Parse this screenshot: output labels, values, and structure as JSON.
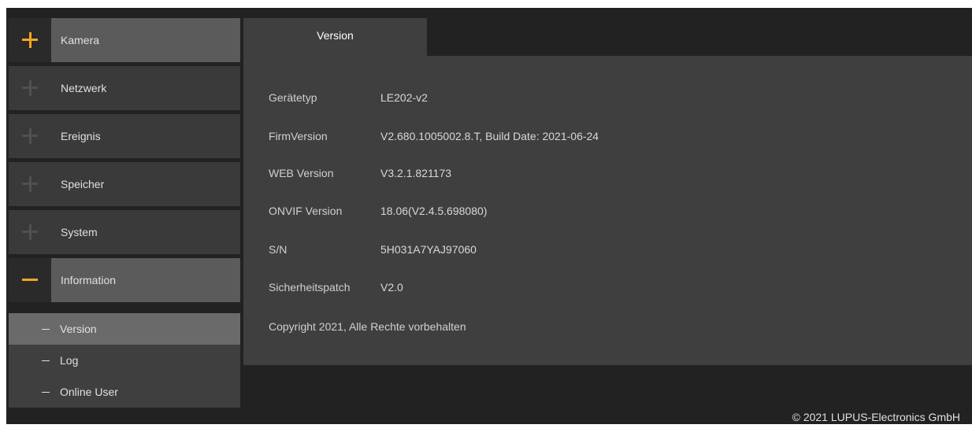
{
  "sidebar": {
    "items": [
      {
        "label": "Kamera",
        "icon": "plus-icon"
      },
      {
        "label": "Netzwerk",
        "icon": "plus-icon"
      },
      {
        "label": "Ereignis",
        "icon": "plus-icon"
      },
      {
        "label": "Speicher",
        "icon": "plus-icon"
      },
      {
        "label": "System",
        "icon": "plus-icon"
      },
      {
        "label": "Information",
        "icon": "minus-icon"
      }
    ],
    "subitems": [
      {
        "label": "Version"
      },
      {
        "label": "Log"
      },
      {
        "label": "Online User"
      }
    ]
  },
  "tab": {
    "label": "Version"
  },
  "info": {
    "rows": [
      {
        "label": "Gerätetyp",
        "value": "LE202-v2"
      },
      {
        "label": "FirmVersion",
        "value": "V2.680.1005002.8.T, Build Date: 2021-06-24"
      },
      {
        "label": "WEB Version",
        "value": "V3.2.1.821173"
      },
      {
        "label": "ONVIF Version",
        "value": "18.06(V2.4.5.698080)"
      },
      {
        "label": "S/N",
        "value": "5H031A7YAJ97060"
      },
      {
        "label": "Sicherheitspatch",
        "value": "V2.0"
      }
    ],
    "copyright": "Copyright 2021, Alle Rechte vorbehalten"
  },
  "footer": {
    "text": "© 2021 LUPUS-Electronics GmbH"
  },
  "colors": {
    "accent": "#f5a623",
    "background": "#222222",
    "panel": "#3f3f3f"
  }
}
